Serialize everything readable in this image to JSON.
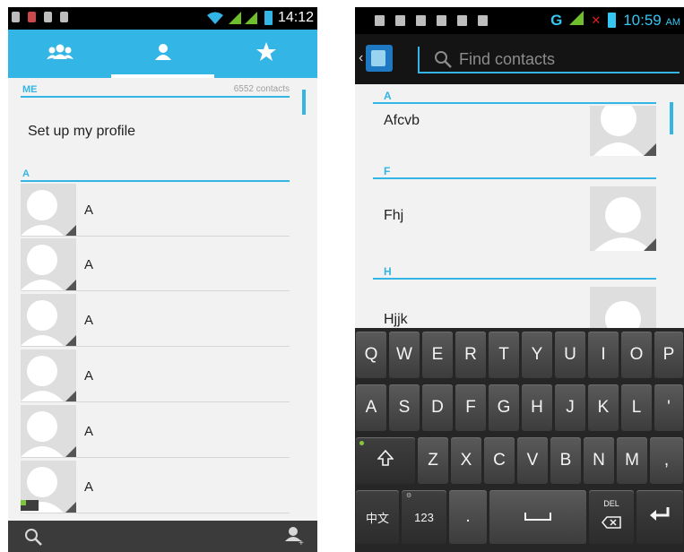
{
  "left_screen": {
    "status_bar": {
      "time": "14:12"
    },
    "tabs": [
      {
        "name": "groups",
        "icon": "group-icon"
      },
      {
        "name": "all-contacts",
        "icon": "person-icon",
        "selected": true
      },
      {
        "name": "favorites",
        "icon": "star-icon"
      }
    ],
    "me_section": {
      "label": "ME",
      "count": "6552 contacts",
      "profile_text": "Set up my profile"
    },
    "section_a": {
      "label": "A"
    },
    "contacts": [
      {
        "name": "A"
      },
      {
        "name": "A"
      },
      {
        "name": "A"
      },
      {
        "name": "A"
      },
      {
        "name": "A"
      },
      {
        "name": "A"
      }
    ],
    "bottom_bar": {
      "left_icon": "search-icon",
      "right_icon": "add-contact-icon"
    }
  },
  "right_screen": {
    "status_bar": {
      "network": "G",
      "time": "10:59",
      "ampm": "AM"
    },
    "search": {
      "placeholder": "Find contacts"
    },
    "sections": [
      {
        "header": "A",
        "name": "Afcvb"
      },
      {
        "header": "F",
        "name": "Fhj"
      },
      {
        "header": "H",
        "name": "Hjjk"
      }
    ],
    "keyboard": {
      "row1": [
        "Q",
        "W",
        "E",
        "R",
        "T",
        "Y",
        "U",
        "I",
        "O",
        "P"
      ],
      "row2": [
        "A",
        "S",
        "D",
        "F",
        "G",
        "H",
        "J",
        "K",
        "L",
        "'"
      ],
      "row3": [
        "Z",
        "X",
        "C",
        "V",
        "B",
        "N",
        "M",
        ","
      ],
      "lang_key": "中文",
      "num_key": "123",
      "period_key": ".",
      "del_label": "DEL"
    }
  },
  "colors": {
    "accent": "#33b5e5",
    "status_bar": "#000000",
    "keyboard_bg": "#262626"
  }
}
